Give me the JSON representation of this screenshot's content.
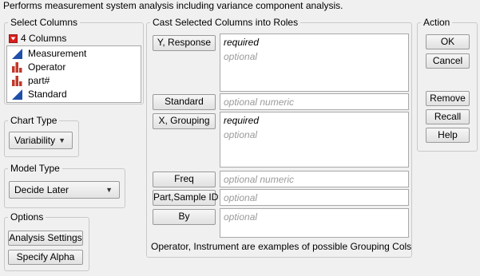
{
  "description": "Performs measurement system analysis including variance component analysis.",
  "select_columns": {
    "title": "Select Columns",
    "count_label": "4 Columns",
    "columns": [
      {
        "name": "Measurement",
        "icon": "continuous-icon"
      },
      {
        "name": "Operator",
        "icon": "nominal-icon"
      },
      {
        "name": "part#",
        "icon": "nominal-icon"
      },
      {
        "name": "Standard",
        "icon": "continuous-icon"
      }
    ]
  },
  "chart_type": {
    "title": "Chart Type",
    "selected": "Variability"
  },
  "model_type": {
    "title": "Model Type",
    "selected": "Decide Later"
  },
  "options": {
    "title": "Options",
    "analysis_settings": "Analysis Settings",
    "specify_alpha": "Specify Alpha"
  },
  "cast": {
    "title": "Cast Selected Columns into Roles",
    "roles": {
      "y": {
        "label": "Y, Response",
        "line1": "required",
        "line2": "optional"
      },
      "standard": {
        "label": "Standard",
        "placeholder": "optional numeric"
      },
      "x": {
        "label": "X, Grouping",
        "line1": "required",
        "line2": "optional"
      },
      "freq": {
        "label": "Freq",
        "placeholder": "optional numeric"
      },
      "part": {
        "label": "Part,Sample ID",
        "placeholder": "optional"
      },
      "by": {
        "label": "By",
        "placeholder": "optional"
      }
    },
    "hint": "Operator, Instrument are examples of possible Grouping Cols"
  },
  "action": {
    "title": "Action",
    "ok": "OK",
    "cancel": "Cancel",
    "remove": "Remove",
    "recall": "Recall",
    "help": "Help"
  },
  "colors": {
    "continuous_icon": "#1f4fa8",
    "nominal_icon": "#c0392b",
    "disclosure": "#d81e1e"
  }
}
